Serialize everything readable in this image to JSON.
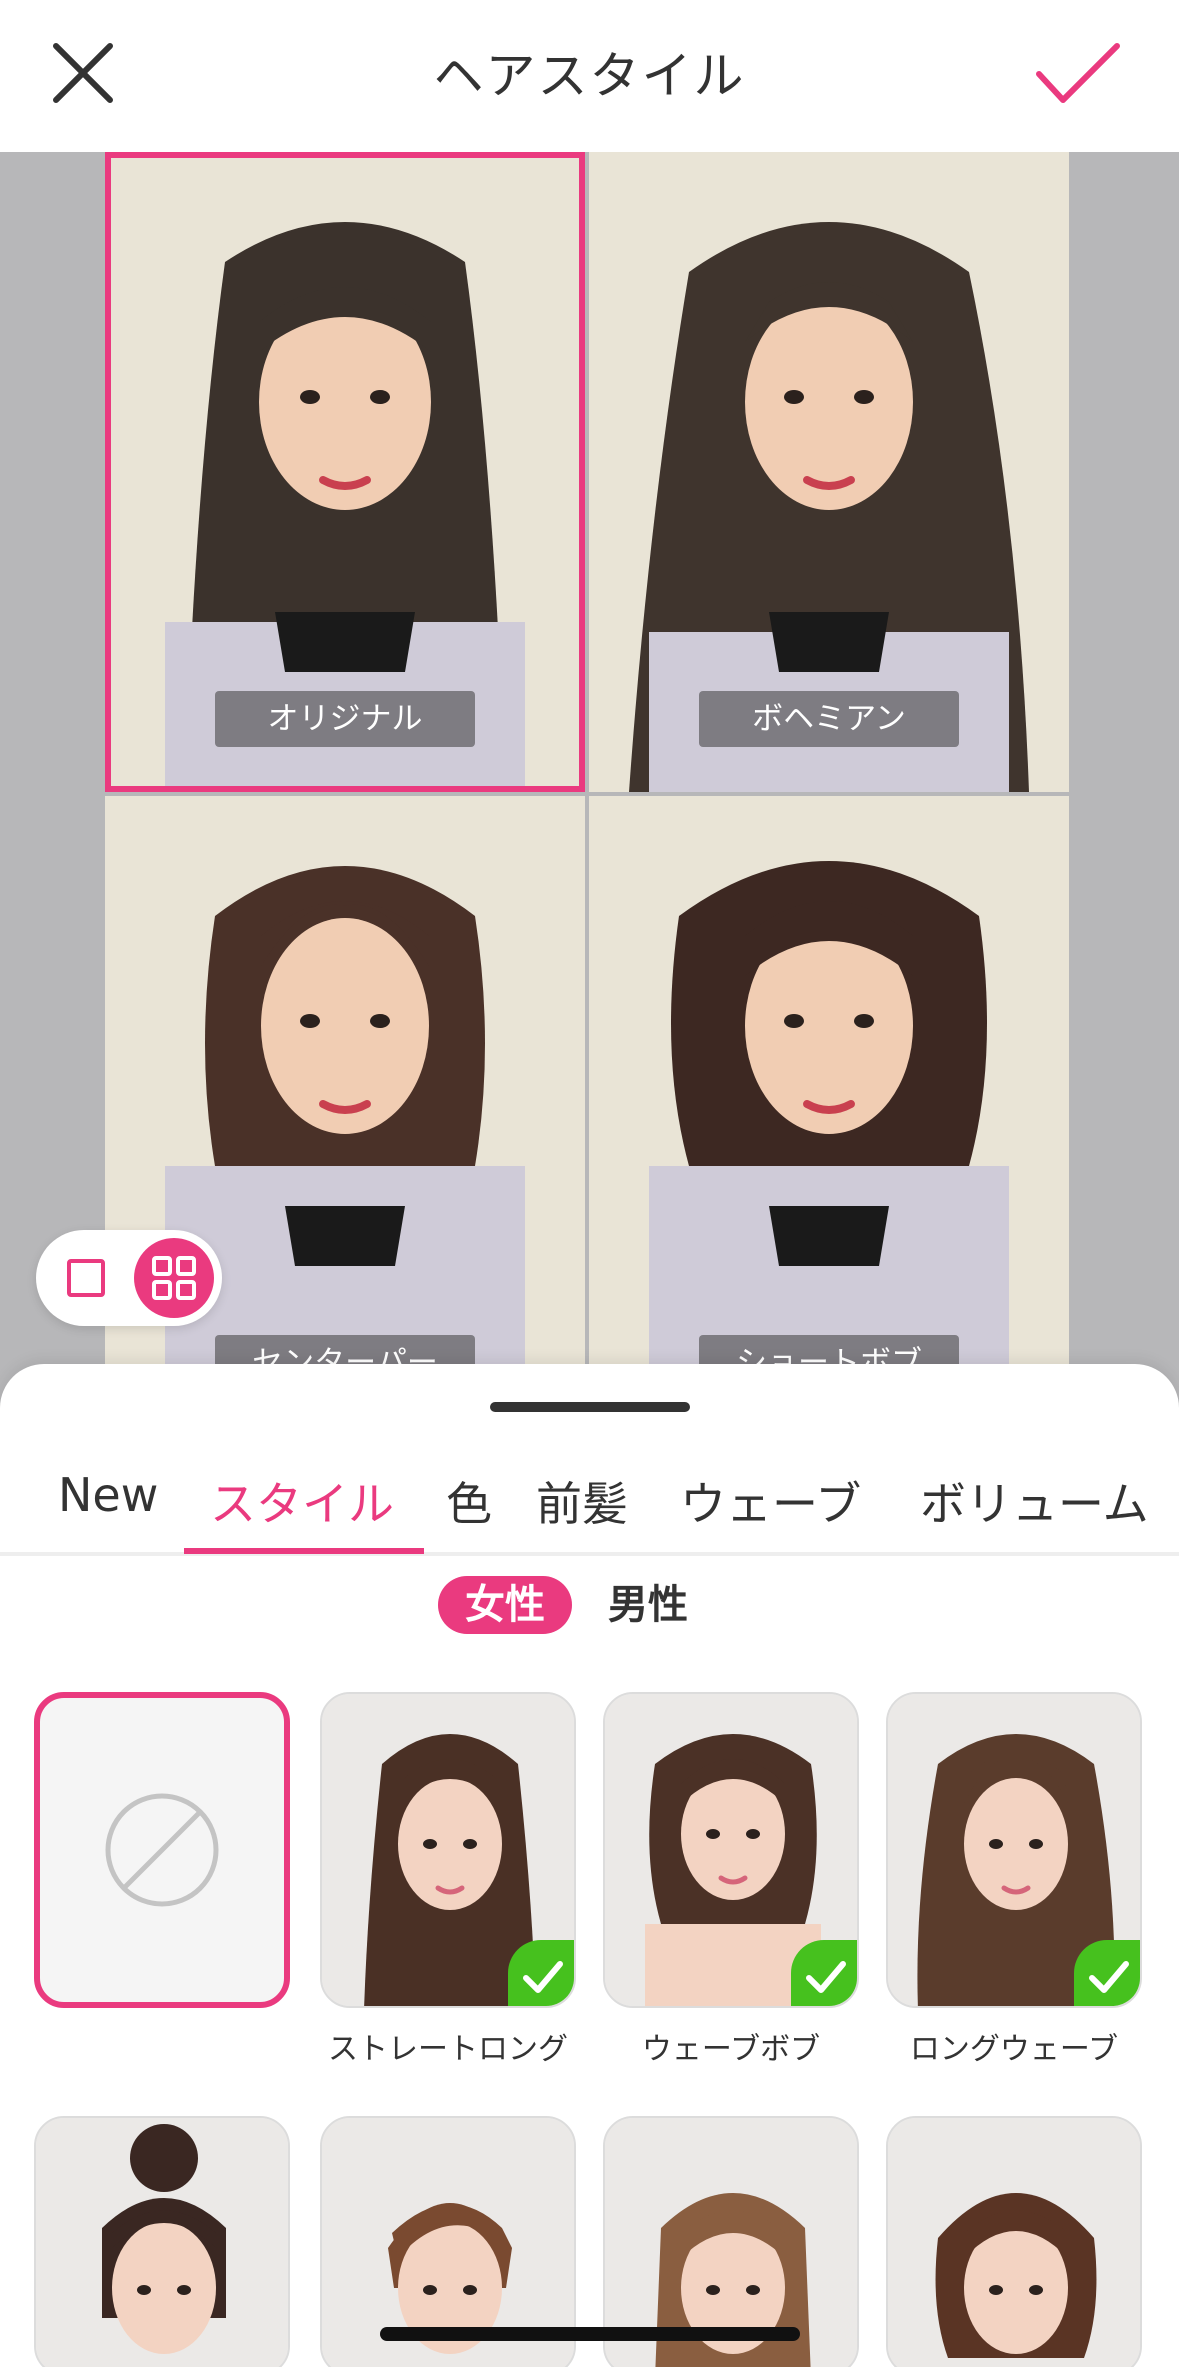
{
  "header": {
    "title": "ヘアスタイル",
    "close_icon": "close-icon",
    "confirm_icon": "check-icon",
    "accent": "#ea3a7f"
  },
  "preview": {
    "cells": [
      {
        "label": "オリジナル",
        "selected": true
      },
      {
        "label": "ボヘミアン",
        "selected": false
      },
      {
        "label": "センターパートボブ",
        "selected": false
      },
      {
        "label": "ショートボブ",
        "selected": false
      }
    ],
    "view_toggle": {
      "single_icon": "single-view-icon",
      "grid_icon": "grid-view-icon",
      "active": "grid"
    }
  },
  "tabs": [
    "New",
    "スタイル",
    "色",
    "前髪",
    "ウェーブ",
    "ボリューム"
  ],
  "active_tab": "スタイル",
  "gender": {
    "female": "女性",
    "male": "男性",
    "active": "女性"
  },
  "styles": {
    "row1": [
      {
        "label": "",
        "type": "none",
        "icon": "none-icon"
      },
      {
        "label": "ストレートロング",
        "checked": true
      },
      {
        "label": "ウェーブボブ",
        "checked": true
      },
      {
        "label": "ロングウェーブ",
        "checked": true
      }
    ]
  }
}
